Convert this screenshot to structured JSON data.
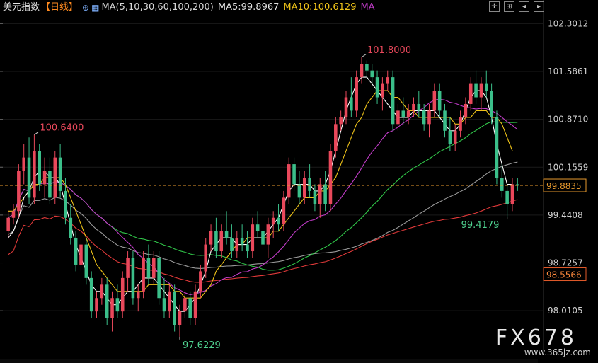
{
  "header": {
    "title": "美元指数",
    "period": "【日线】",
    "ma_label": "MA(5,10,30,60,100,200)",
    "ma5": "MA5:99.8967",
    "ma10": "MA10:100.6129",
    "ma_more": "MA"
  },
  "toolbar": [
    "crosshair-icon",
    "grid-icon",
    "back-icon",
    "forward-icon"
  ],
  "watermark": {
    "main": "FX678",
    "sub": "www.365jz.com"
  },
  "colors": {
    "up": "#e9485b",
    "down": "#3bbf8a",
    "ma5": "#ffffff",
    "ma10": "#f0c419",
    "ma30": "#c23cc9",
    "ma60": "#31c84a",
    "ma100": "#9a9a9a",
    "ma200": "#e23a3a",
    "dash": "#e89a2e"
  },
  "chart_data": {
    "type": "candlestick",
    "y_ticks": [
      "102.3012",
      "101.5861",
      "100.8710",
      "100.1559",
      "99.4408",
      "98.7257",
      "98.0105"
    ],
    "ylim": [
      97.6,
      102.4
    ],
    "current_price": "99.8835",
    "level_label": "98.5566",
    "annotations": [
      {
        "label": "100.6400",
        "value": 100.64,
        "index": 5
      },
      {
        "label": "101.8000",
        "value": 101.8,
        "index": 68
      },
      {
        "label": "97.6229",
        "value": 97.6229,
        "index": 33
      },
      {
        "label": "99.4179",
        "value": 99.4179,
        "index": 96
      }
    ],
    "candles": [
      [
        99.2,
        99.5,
        99.1,
        99.4
      ],
      [
        99.4,
        99.6,
        99.3,
        99.5
      ],
      [
        99.5,
        100.2,
        99.4,
        100.1
      ],
      [
        100.1,
        100.5,
        99.9,
        100.3
      ],
      [
        100.3,
        100.6,
        99.6,
        99.7
      ],
      [
        99.7,
        100.64,
        99.6,
        100.4
      ],
      [
        100.4,
        100.5,
        99.8,
        99.9
      ],
      [
        99.9,
        100.3,
        99.7,
        100.1
      ],
      [
        100.1,
        100.3,
        99.6,
        99.7
      ],
      [
        99.7,
        100.4,
        99.6,
        100.3
      ],
      [
        100.3,
        100.5,
        99.7,
        99.8
      ],
      [
        99.8,
        100.0,
        99.3,
        99.4
      ],
      [
        99.4,
        99.6,
        99.0,
        99.1
      ],
      [
        99.1,
        99.2,
        98.6,
        98.7
      ],
      [
        98.7,
        99.1,
        98.6,
        99.0
      ],
      [
        99.0,
        99.1,
        98.4,
        98.5
      ],
      [
        98.5,
        98.6,
        97.9,
        98.0
      ],
      [
        98.0,
        98.3,
        97.9,
        98.2
      ],
      [
        98.2,
        98.5,
        98.1,
        98.4
      ],
      [
        98.4,
        98.5,
        97.8,
        97.9
      ],
      [
        97.9,
        98.3,
        97.7,
        98.2
      ],
      [
        98.2,
        98.4,
        97.9,
        98.0
      ],
      [
        98.0,
        98.6,
        97.9,
        98.5
      ],
      [
        98.5,
        98.9,
        98.3,
        98.8
      ],
      [
        98.8,
        98.9,
        98.1,
        98.2
      ],
      [
        98.2,
        98.4,
        98.0,
        98.3
      ],
      [
        98.3,
        98.9,
        98.2,
        98.8
      ],
      [
        98.8,
        99.0,
        98.4,
        98.5
      ],
      [
        98.5,
        98.9,
        98.4,
        98.8
      ],
      [
        98.8,
        98.9,
        98.1,
        98.2
      ],
      [
        98.2,
        98.5,
        97.9,
        98.0
      ],
      [
        98.0,
        98.4,
        97.9,
        98.3
      ],
      [
        98.3,
        98.4,
        97.7,
        97.8
      ],
      [
        97.8,
        98.1,
        97.6229,
        98.0
      ],
      [
        98.0,
        98.3,
        97.9,
        98.2
      ],
      [
        98.2,
        98.3,
        97.8,
        97.9
      ],
      [
        97.9,
        98.4,
        97.8,
        98.3
      ],
      [
        98.3,
        98.7,
        98.2,
        98.6
      ],
      [
        98.6,
        99.1,
        98.5,
        99.0
      ],
      [
        99.0,
        99.3,
        98.9,
        99.2
      ],
      [
        99.2,
        99.4,
        98.8,
        98.9
      ],
      [
        98.9,
        99.3,
        98.8,
        99.2
      ],
      [
        99.2,
        99.5,
        99.0,
        99.1
      ],
      [
        99.1,
        99.3,
        98.8,
        98.9
      ],
      [
        98.9,
        99.2,
        98.8,
        99.1
      ],
      [
        99.1,
        99.3,
        98.9,
        99.0
      ],
      [
        99.0,
        99.2,
        98.8,
        98.9
      ],
      [
        98.9,
        99.4,
        98.8,
        99.3
      ],
      [
        99.3,
        99.5,
        99.1,
        99.2
      ],
      [
        99.2,
        99.3,
        98.9,
        99.0
      ],
      [
        99.0,
        99.4,
        98.8,
        99.3
      ],
      [
        99.3,
        99.5,
        99.1,
        99.4
      ],
      [
        99.4,
        99.6,
        99.2,
        99.3
      ],
      [
        99.3,
        99.8,
        99.2,
        99.7
      ],
      [
        99.7,
        100.3,
        99.6,
        100.2
      ],
      [
        100.2,
        100.3,
        99.8,
        99.9
      ],
      [
        99.9,
        100.1,
        99.6,
        99.7
      ],
      [
        99.7,
        100.1,
        99.6,
        100.0
      ],
      [
        100.0,
        100.2,
        99.7,
        99.8
      ],
      [
        99.8,
        99.9,
        99.5,
        99.6
      ],
      [
        99.6,
        100.0,
        99.4,
        99.9
      ],
      [
        99.9,
        100.1,
        99.5,
        99.6
      ],
      [
        99.6,
        100.5,
        99.5,
        100.4
      ],
      [
        100.4,
        100.9,
        100.3,
        100.8
      ],
      [
        100.8,
        101.0,
        100.7,
        100.9
      ],
      [
        100.9,
        101.3,
        100.8,
        101.2
      ],
      [
        101.2,
        101.5,
        100.9,
        101.0
      ],
      [
        101.0,
        101.6,
        100.9,
        101.5
      ],
      [
        101.5,
        101.8,
        101.4,
        101.7
      ],
      [
        101.7,
        101.75,
        101.5,
        101.6
      ],
      [
        101.6,
        101.7,
        101.4,
        101.5
      ],
      [
        101.5,
        101.6,
        101.1,
        101.2
      ],
      [
        101.2,
        101.5,
        101.0,
        101.4
      ],
      [
        101.4,
        101.6,
        101.3,
        101.5
      ],
      [
        101.5,
        101.6,
        100.7,
        100.8
      ],
      [
        100.8,
        101.1,
        100.7,
        101.0
      ],
      [
        101.0,
        101.2,
        100.8,
        100.9
      ],
      [
        100.9,
        101.1,
        100.8,
        101.0
      ],
      [
        101.0,
        101.2,
        100.9,
        101.1
      ],
      [
        101.1,
        101.3,
        100.9,
        101.0
      ],
      [
        101.0,
        101.1,
        100.7,
        100.8
      ],
      [
        100.8,
        101.1,
        100.6,
        101.0
      ],
      [
        101.0,
        101.4,
        100.9,
        101.3
      ],
      [
        101.3,
        101.4,
        100.9,
        101.0
      ],
      [
        101.0,
        101.1,
        100.6,
        100.7
      ],
      [
        100.7,
        100.9,
        100.4,
        100.5
      ],
      [
        100.5,
        100.8,
        100.4,
        100.7
      ],
      [
        100.7,
        101.0,
        100.6,
        100.9
      ],
      [
        100.9,
        101.2,
        100.8,
        101.1
      ],
      [
        101.1,
        101.5,
        101.0,
        101.4
      ],
      [
        101.4,
        101.6,
        101.1,
        101.2
      ],
      [
        101.2,
        101.5,
        101.0,
        101.4
      ],
      [
        101.4,
        101.6,
        101.2,
        101.3
      ],
      [
        101.3,
        101.4,
        100.8,
        100.9
      ],
      [
        100.9,
        101.0,
        99.9,
        100.0
      ],
      [
        100.0,
        100.2,
        99.7,
        99.8
      ],
      [
        99.8,
        99.9,
        99.4179,
        99.6
      ],
      [
        99.6,
        100.0,
        99.5,
        99.9
      ],
      [
        99.9,
        100.0,
        99.8,
        99.88
      ]
    ],
    "ma5": [
      99.1,
      99.2,
      99.4,
      99.7,
      99.8,
      100.0,
      100.1,
      100.1,
      100.0,
      100.0,
      99.9,
      99.6,
      99.3,
      99.0,
      98.8,
      98.6,
      98.4,
      98.3,
      98.3,
      98.2,
      98.1,
      98.1,
      98.2,
      98.3,
      98.3,
      98.4,
      98.5,
      98.5,
      98.5,
      98.4,
      98.3,
      98.2,
      98.1,
      98.0,
      98.0,
      98.1,
      98.2,
      98.4,
      98.6,
      98.9,
      99.0,
      99.1,
      99.1,
      99.1,
      99.0,
      99.0,
      99.0,
      99.1,
      99.1,
      99.1,
      99.2,
      99.3,
      99.4,
      99.6,
      99.8,
      99.9,
      99.9,
      99.9,
      99.9,
      99.8,
      99.8,
      99.9,
      100.1,
      100.4,
      100.7,
      101.0,
      101.2,
      101.4,
      101.5,
      101.5,
      101.4,
      101.3,
      101.2,
      101.1,
      101.0,
      100.9,
      100.9,
      100.9,
      101.0,
      101.0,
      101.0,
      101.0,
      101.0,
      100.9,
      100.8,
      100.7,
      100.7,
      100.8,
      101.0,
      101.2,
      101.3,
      101.3,
      101.2,
      100.9,
      100.5,
      100.2,
      99.9,
      99.9
    ],
    "ma10": [
      99.5,
      99.5,
      99.6,
      99.7,
      99.8,
      99.9,
      99.9,
      100.0,
      100.0,
      100.0,
      100.0,
      99.9,
      99.7,
      99.5,
      99.3,
      99.1,
      98.9,
      98.7,
      98.6,
      98.5,
      98.4,
      98.3,
      98.3,
      98.3,
      98.3,
      98.3,
      98.3,
      98.4,
      98.4,
      98.4,
      98.4,
      98.4,
      98.3,
      98.3,
      98.2,
      98.2,
      98.2,
      98.2,
      98.3,
      98.4,
      98.6,
      98.7,
      98.8,
      98.9,
      99.0,
      99.0,
      99.1,
      99.1,
      99.1,
      99.1,
      99.1,
      99.2,
      99.2,
      99.3,
      99.4,
      99.5,
      99.6,
      99.7,
      99.7,
      99.7,
      99.8,
      99.8,
      99.9,
      100.0,
      100.2,
      100.4,
      100.6,
      100.8,
      100.9,
      101.1,
      101.2,
      101.3,
      101.3,
      101.3,
      101.2,
      101.2,
      101.1,
      101.0,
      101.0,
      100.9,
      100.9,
      100.9,
      100.9,
      100.9,
      100.9,
      100.9,
      100.8,
      100.8,
      100.9,
      100.9,
      101.0,
      101.0,
      101.0,
      100.9,
      100.9,
      100.8,
      100.6,
      100.4
    ]
  }
}
